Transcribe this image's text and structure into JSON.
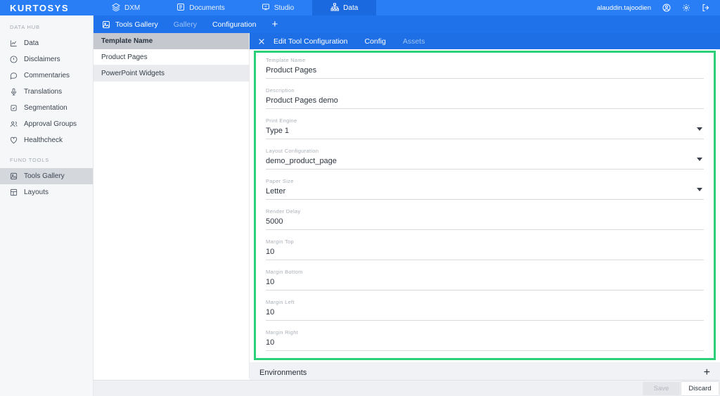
{
  "topbar": {
    "logo": "KURTOSYS",
    "nav": [
      {
        "label": "DXM"
      },
      {
        "label": "Documents"
      },
      {
        "label": "Studio"
      },
      {
        "label": "Data"
      }
    ],
    "username": "alauddin.tajoodien"
  },
  "sidebar": {
    "sections": [
      {
        "label": "DATA HUB",
        "items": [
          {
            "label": "Data"
          },
          {
            "label": "Disclaimers"
          },
          {
            "label": "Commentaries"
          },
          {
            "label": "Translations"
          },
          {
            "label": "Segmentation"
          },
          {
            "label": "Approval Groups"
          },
          {
            "label": "Healthcheck"
          }
        ]
      },
      {
        "label": "FUND TOOLS",
        "items": [
          {
            "label": "Tools Gallery"
          },
          {
            "label": "Layouts"
          }
        ]
      }
    ]
  },
  "toolbar": {
    "title": "Tools Gallery",
    "tab_gallery": "Gallery",
    "tab_configuration": "Configuration",
    "add_label": "+"
  },
  "list": {
    "header": "Template Name",
    "rows": [
      {
        "name": "Product Pages"
      },
      {
        "name": "PowerPoint Widgets"
      }
    ]
  },
  "editor": {
    "title": "Edit Tool Configuration",
    "tab_config": "Config",
    "tab_assets": "Assets"
  },
  "form": {
    "fields": [
      {
        "label": "Template Name",
        "value": "Product Pages"
      },
      {
        "label": "Description",
        "value": "Product Pages demo"
      },
      {
        "label": "Print Engine",
        "value": "Type 1"
      },
      {
        "label": "Layout Configuration",
        "value": "demo_product_page"
      },
      {
        "label": "Paper Size",
        "value": "Letter"
      },
      {
        "label": "Render Delay",
        "value": "5000"
      },
      {
        "label": "Margin Top",
        "value": "10"
      },
      {
        "label": "Margin Bottom",
        "value": "10"
      },
      {
        "label": "Margin Left",
        "value": "10"
      },
      {
        "label": "Margin Right",
        "value": "10"
      }
    ]
  },
  "environments": {
    "title": "Environments",
    "add_label": "+"
  },
  "footer": {
    "save_label": "Save",
    "discard_label": "Discard"
  },
  "colors": {
    "accent_blue": "#2a7ef5",
    "active_blue": "#1b69de",
    "highlight_green": "#2dd079"
  }
}
